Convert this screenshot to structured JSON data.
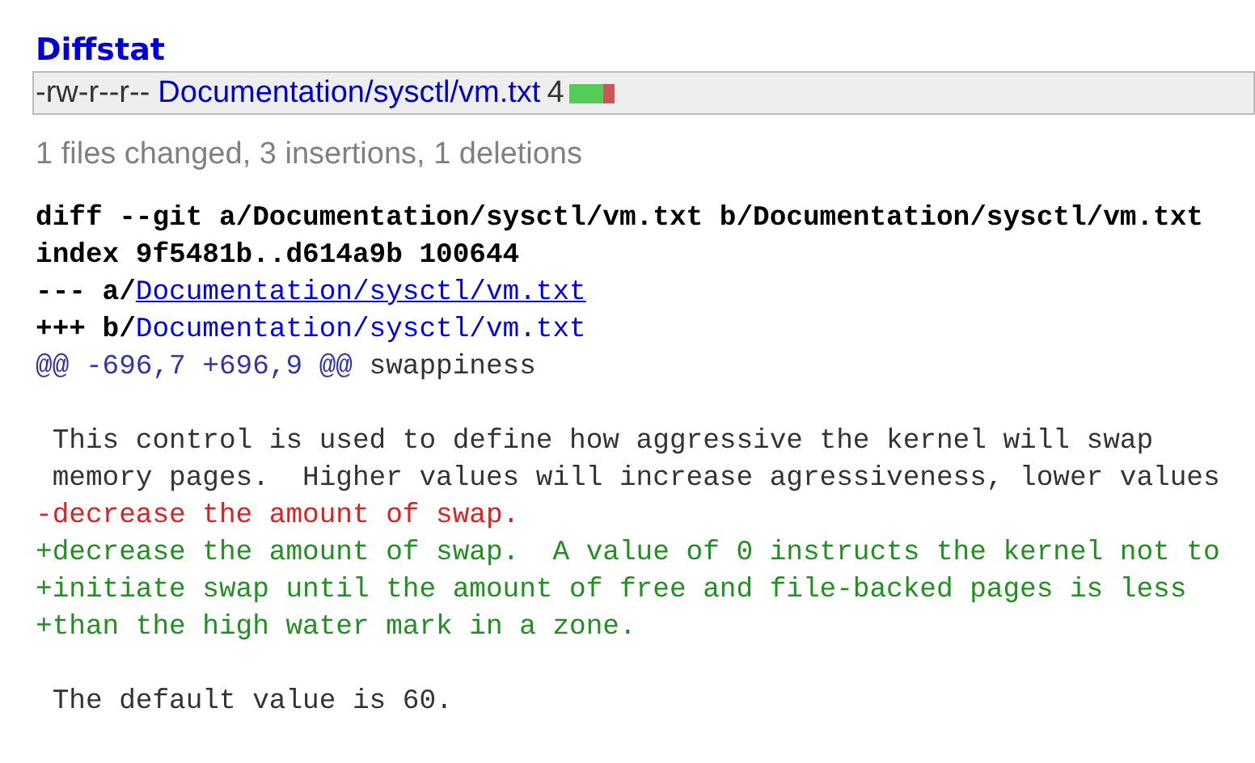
{
  "diffstat": {
    "title": "Diffstat",
    "files": [
      {
        "mode": "-rw-r--r--",
        "path": "Documentation/sysctl/vm.txt",
        "changes": "4",
        "level": 0.75
      }
    ],
    "summary": "1 files changed, 3 insertions, 1 deletions"
  },
  "diff": {
    "lines": [
      {
        "kind": "header",
        "text": "diff --git a/Documentation/sysctl/vm.txt b/Documentation/sysctl/vm.txt"
      },
      {
        "kind": "header",
        "text": "index 9f5481b..d614a9b 100644"
      },
      {
        "kind": "file",
        "prefix": "--- a/",
        "path": "Documentation/sysctl/vm.txt",
        "underlined": true
      },
      {
        "kind": "file",
        "prefix": "+++ b/",
        "path": "Documentation/sysctl/vm.txt",
        "underlined": false
      },
      {
        "kind": "hunk",
        "range": "@@ -696,7 +696,9 @@",
        "text": " swappiness"
      },
      {
        "kind": "blank"
      },
      {
        "kind": "context",
        "text": " This control is used to define how aggressive the kernel will swap"
      },
      {
        "kind": "context",
        "text": " memory pages.  Higher values will increase agressiveness, lower values"
      },
      {
        "kind": "del",
        "text": "-decrease the amount of swap."
      },
      {
        "kind": "add",
        "text": "+decrease the amount of swap.  A value of 0 instructs the kernel not to"
      },
      {
        "kind": "add",
        "text": "+initiate swap until the amount of free and file-backed pages is less"
      },
      {
        "kind": "add",
        "text": "+than the high water mark in a zone."
      },
      {
        "kind": "blank"
      },
      {
        "kind": "context",
        "text": " The default value is 60."
      }
    ]
  }
}
